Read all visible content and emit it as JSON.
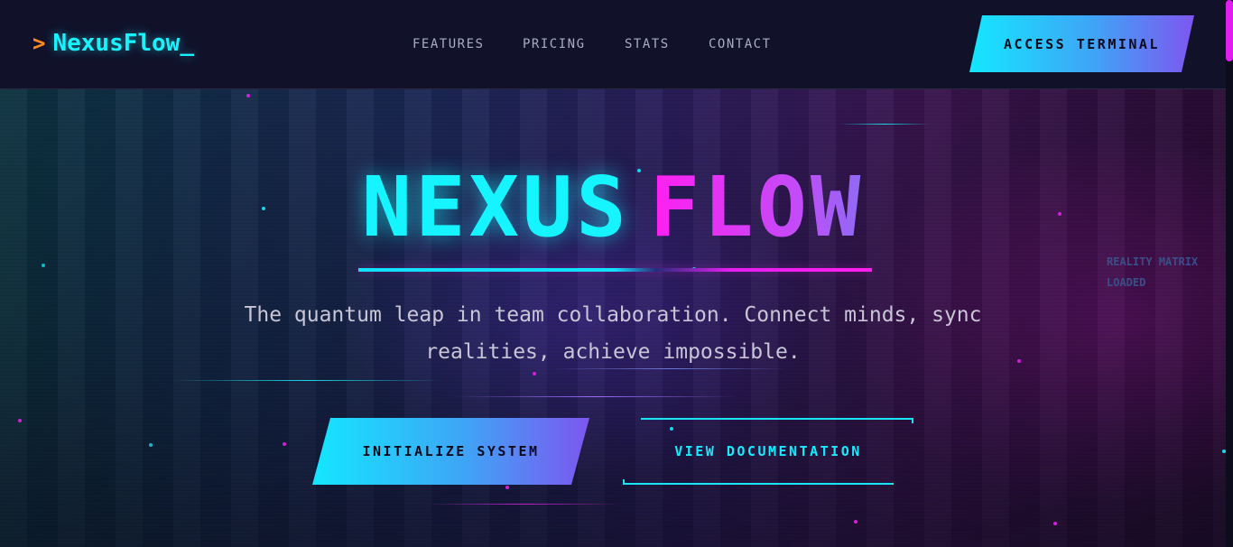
{
  "header": {
    "brand_caret": ">",
    "brand_name": "NexusFlow_",
    "nav": [
      "FEATURES",
      "PRICING",
      "STATS",
      "CONTACT"
    ],
    "cta_label": "ACCESS TERMINAL"
  },
  "hero": {
    "title_part1": "NEXUS",
    "title_part2": "FLOW",
    "tagline": "The quantum leap in team collaboration. Connect minds, sync realities, achieve impossible.",
    "side_note": "REALITY MATRIX LOADED",
    "primary_cta": "INITIALIZE SYSTEM",
    "secondary_cta": "VIEW DOCUMENTATION"
  },
  "colors": {
    "accent_cyan": "#19f2ff",
    "accent_magenta": "#ff1ff0",
    "accent_violet": "#7e56f0",
    "caret_orange": "#ff8a1c",
    "background": "#0b0a18"
  }
}
